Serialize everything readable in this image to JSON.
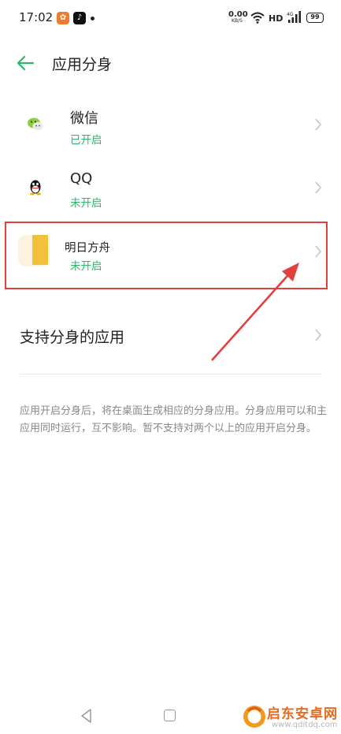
{
  "status_bar": {
    "time": "17:02",
    "speed_value": "0.00",
    "speed_unit": "KB/S",
    "hd": "HD",
    "battery": "99",
    "icons": [
      "notification-app-icon",
      "tiktok-icon",
      "dot-icon",
      "wifi-icon",
      "signal-icon",
      "battery-icon"
    ]
  },
  "header": {
    "title": "应用分身",
    "back_icon": "back-arrow-icon"
  },
  "apps": [
    {
      "name": "微信",
      "status": "已开启",
      "icon": "wechat-icon"
    },
    {
      "name": "QQ",
      "status": "未开启",
      "icon": "qq-icon"
    },
    {
      "name": "明日方舟",
      "status": "未开启",
      "icon": "arknights-icon"
    }
  ],
  "support": {
    "label": "支持分身的应用"
  },
  "note": "应用开启分身后，将在桌面生成相应的分身应用。分身应用可以和主应用同时运行，互不影响。暂不支持对两个以上的应用开启分身。",
  "nav": {
    "icons": [
      "nav-back-icon",
      "nav-home-icon"
    ]
  },
  "watermark": {
    "name": "启东安卓网",
    "url": "www.qdltdq.com"
  },
  "colors": {
    "accent": "#2cb66c",
    "highlight": "#e2403d",
    "text": "#222222",
    "note": "#888888"
  }
}
